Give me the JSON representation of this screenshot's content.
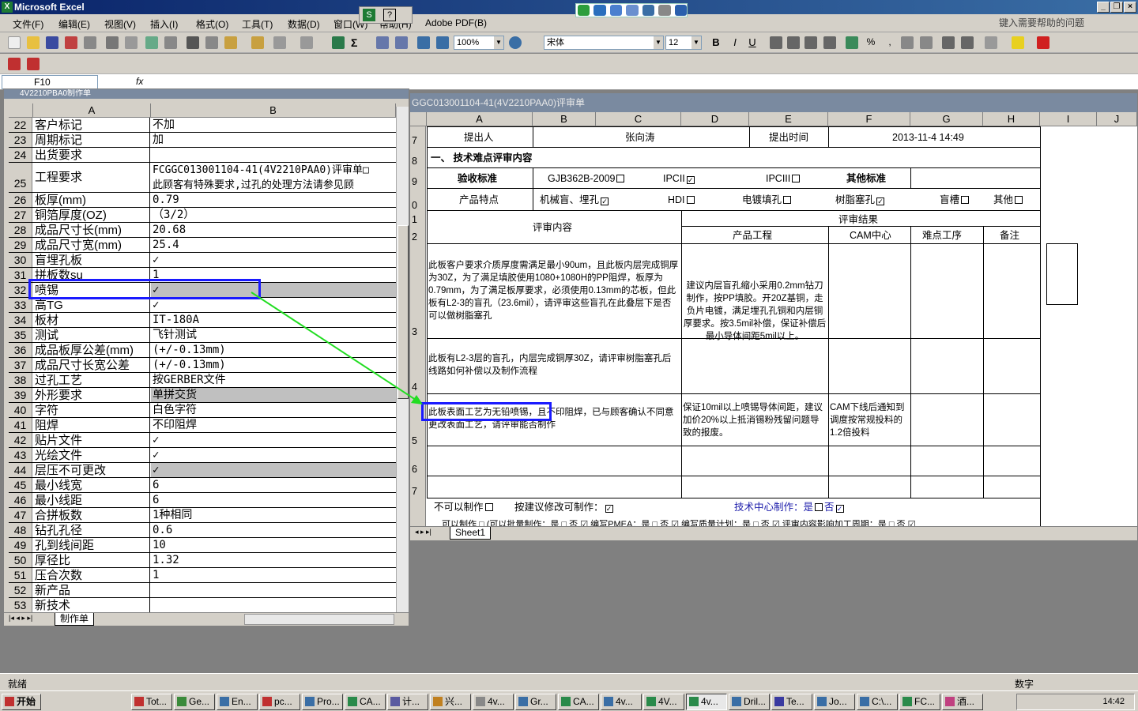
{
  "app": {
    "title": "Microsoft Excel",
    "help_placeholder": "键入需要帮助的问题"
  },
  "menu": [
    "文件(F)",
    "编辑(E)",
    "视图(V)",
    "插入(I)",
    "格式(O)",
    "工具(T)",
    "数据(D)",
    "窗口(W)",
    "帮助(H)",
    "Adobe PDF(B)"
  ],
  "toolbar": {
    "zoom": "100%",
    "font": "宋体",
    "size": "12"
  },
  "formula": {
    "namebox": "F10",
    "fx": "fx"
  },
  "left_window": {
    "title": "4V2210PBA0制作单",
    "col_a": "A",
    "col_b": "B",
    "rows": [
      {
        "n": "22",
        "a": "客户标记",
        "b": "不加"
      },
      {
        "n": "23",
        "a": "周期标记",
        "b": "加"
      },
      {
        "n": "24",
        "a": "出货要求",
        "b": ""
      },
      {
        "n": "25",
        "a": "工程要求",
        "b": "FCGGC013001104-41(4V2210PAA0)评审单□",
        "b2": "此顾客有特殊要求,过孔的处理方法请参见顾"
      },
      {
        "n": "26",
        "a": "板厚(mm)",
        "b": "0.79"
      },
      {
        "n": "27",
        "a": "铜箔厚度(OZ)",
        "b": "（3/2）"
      },
      {
        "n": "28",
        "a": "成品尺寸长(mm)",
        "b": "20.68"
      },
      {
        "n": "29",
        "a": "成品尺寸宽(mm)",
        "b": "25.4"
      },
      {
        "n": "30",
        "a": "盲埋孔板",
        "b": "✓"
      },
      {
        "n": "31",
        "a": "拼板数su",
        "b": "1"
      },
      {
        "n": "32",
        "a": "喷锡",
        "b": "✓"
      },
      {
        "n": "33",
        "a": "高TG",
        "b": "✓"
      },
      {
        "n": "34",
        "a": "板材",
        "b": "IT-180A"
      },
      {
        "n": "35",
        "a": "测试",
        "b": "飞针测试"
      },
      {
        "n": "36",
        "a": "成品板厚公差(mm)",
        "b": "(+/-0.13mm)"
      },
      {
        "n": "37",
        "a": "成品尺寸长宽公差",
        "b": "(+/-0.13mm)"
      },
      {
        "n": "38",
        "a": "过孔工艺",
        "b": "按GERBER文件"
      },
      {
        "n": "39",
        "a": "外形要求",
        "b": "单拼交货"
      },
      {
        "n": "40",
        "a": "字符",
        "b": "白色字符"
      },
      {
        "n": "41",
        "a": "阻焊",
        "b": "不印阻焊"
      },
      {
        "n": "42",
        "a": "贴片文件",
        "b": "✓"
      },
      {
        "n": "43",
        "a": "光绘文件",
        "b": "✓"
      },
      {
        "n": "44",
        "a": "层压不可更改",
        "b": "✓"
      },
      {
        "n": "45",
        "a": "最小线宽",
        "b": "6"
      },
      {
        "n": "46",
        "a": "最小线距",
        "b": "6"
      },
      {
        "n": "47",
        "a": "合拼板数",
        "b": "1种相同"
      },
      {
        "n": "48",
        "a": "钻孔孔径",
        "b": "0.6"
      },
      {
        "n": "49",
        "a": "孔到线间距",
        "b": "10"
      },
      {
        "n": "50",
        "a": "厚径比",
        "b": "1.32"
      },
      {
        "n": "51",
        "a": "压合次数",
        "b": "1"
      },
      {
        "n": "52",
        "a": "新产品",
        "b": ""
      },
      {
        "n": "53",
        "a": "新技术",
        "b": ""
      }
    ],
    "sheet_tab": "制作单"
  },
  "right_window": {
    "title": "GGC013001104-41(4V2210PAA0)评审单",
    "cols": [
      "A",
      "B",
      "C",
      "D",
      "E",
      "F",
      "G",
      "H",
      "I",
      "J"
    ],
    "r7": {
      "proposer_label": "提出人",
      "proposer": "张向涛",
      "time_label": "提出时间",
      "time": "2013-11-4 14:49"
    },
    "r8": "一、 技术难点评审内容",
    "r9": {
      "label": "验收标准",
      "gjb": "GJB362B-2009",
      "ipc2": "IPCII",
      "ipc3": "IPCIII",
      "other": "其他标准"
    },
    "r10": {
      "label": "产品特点",
      "mech": "机械盲、埋孔",
      "hdi": "HDI",
      "plating": "电镀填孔",
      "resin": "树脂塞孔",
      "blind": "盲槽",
      "other": "其他"
    },
    "r11": {
      "content_label": "评审内容",
      "result_label": "评审结果"
    },
    "r12": {
      "eng": "产品工程",
      "cam": "CAM中心",
      "diff": "难点工序",
      "note": "备注"
    },
    "r13": {
      "content": "此板客户要求介质厚度需满足最小90um，且此板内层完成铜厚为30Z，为了满足填胶使用1080+1080H的PP阻焊，板厚为0.79mm，为了满足板厚要求，必须使用0.13mm的芯板，但此板有L2-3的盲孔（23.6mil），请评审这些盲孔在此叠层下是否可以做树脂塞孔",
      "eng": "建议内层盲孔缩小采用0.2mm钻刀制作，按PP填胶。开20Z基铜，走负片电镀，满足埋孔孔铜和内层铜厚要求。按3.5mil补偿，保证补偿后最小导体间距5mil以上。"
    },
    "r14": {
      "content": "此板有L2-3层的盲孔，内层完成铜厚30Z，请评审树脂塞孔后线路如何补偿以及制作流程"
    },
    "r15": {
      "content_hl": "此板表面工艺为无铅喷锡，",
      "content_rest": "且不印阻焊，已与顾客确认不同意更改表面工艺，请评审能否制作",
      "eng": "保证10mil以上喷锡导体间距，建议加价20%以上抵消锡粉残留问题导致的报废。",
      "cam": "CAM下线后通知到调度按常规投料的1.2倍投料"
    },
    "bottom1": {
      "a": "不可以制作",
      "b": "按建议修改可制作：",
      "c": "技术中心制作：是",
      "d": "否"
    },
    "bottom2": "可以制作 □ (可以批量制作：是 □ 否 ☑ 编写PMEA：是 □ 否 ☑ 编写质量计划：是 □ 否 ☑ 评审内容影响加工周期：是 □ 否 ☑",
    "row_nums": [
      "7",
      "8",
      "9",
      "0",
      "1",
      "2",
      "3",
      "4",
      "5",
      "6",
      "7"
    ],
    "sheet_tab": "Sheet1"
  },
  "status": {
    "ready": "就绪",
    "num": "数字"
  },
  "taskbar": {
    "start": "开始",
    "items": [
      "Tot...",
      "Ge...",
      "En...",
      "pc...",
      "Pro...",
      "CA...",
      "计...",
      "兴...",
      "4v...",
      "Gr...",
      "CA...",
      "4v...",
      "4V...",
      "4v...",
      "Dril...",
      "Te...",
      "Jo...",
      "C:\\...",
      "FC...",
      "酒..."
    ],
    "clock": "14:42"
  }
}
